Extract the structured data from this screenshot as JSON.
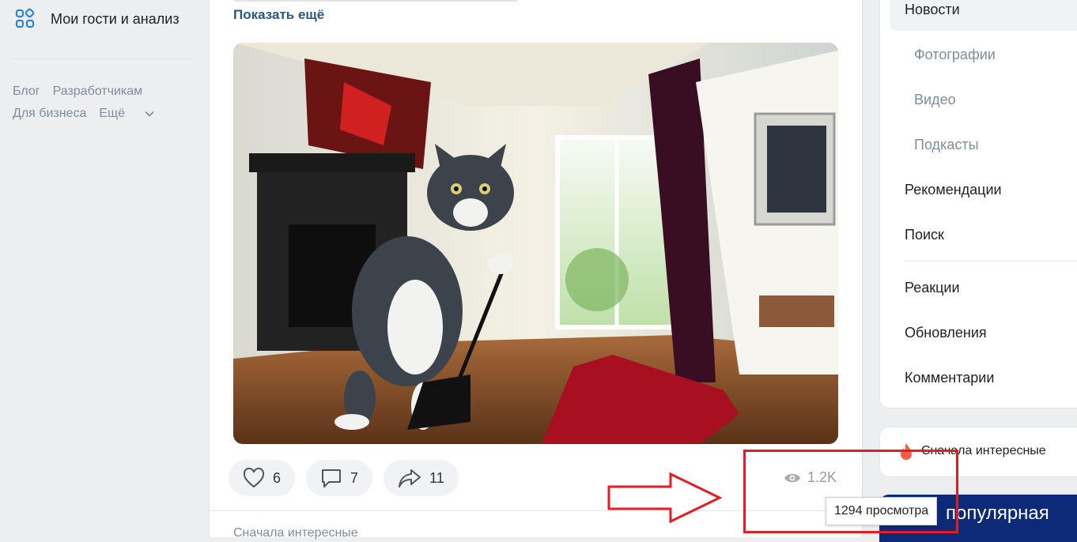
{
  "left_nav": {
    "guests_label": "Мои гости и анализ",
    "footer": [
      "Блог",
      "Разработчикам",
      "Для бизнеса",
      "Ещё"
    ]
  },
  "post": {
    "show_more": "Показать ещё",
    "likes": "6",
    "comments": "7",
    "shares": "11",
    "views": "1.2K",
    "views_tooltip": "1294 просмотра",
    "sort_label": "Сначала интересные"
  },
  "right_menu": {
    "items": [
      "Новости",
      "Фотографии",
      "Видео",
      "Подкасты",
      "Рекомендации",
      "Поиск",
      "Реакции",
      "Обновления",
      "Комментарии"
    ]
  },
  "filter": {
    "label": "Сначала интересные"
  },
  "promo": {
    "text": "популярная"
  },
  "colors": {
    "accent": "#2a5885",
    "annotation": "#e01e25",
    "promo_bg": "#0c2a78"
  }
}
